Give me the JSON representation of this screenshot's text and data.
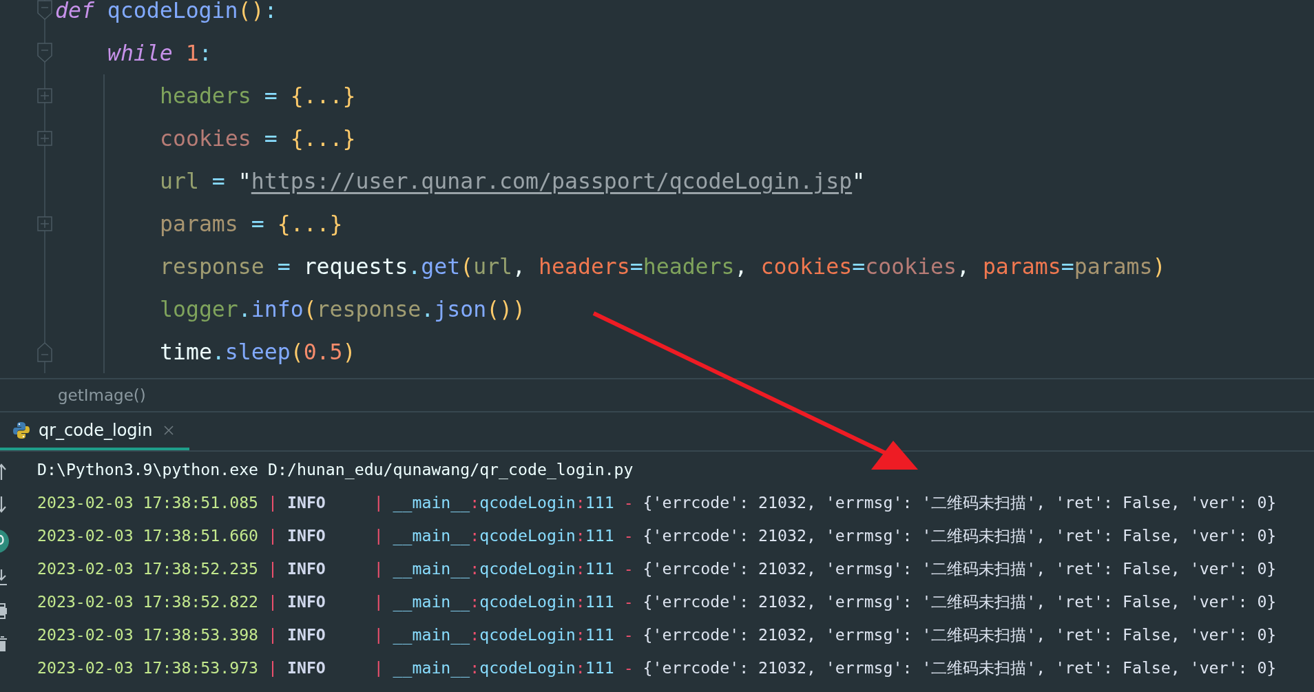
{
  "editor": {
    "code": [
      {
        "kind": "fold-start",
        "tokens": [
          {
            "text": "def",
            "kind": "keyword"
          },
          {
            "text": " qcodeLogin",
            "kind": "function"
          },
          {
            "text": "()",
            "kind": "bracket"
          },
          {
            "text": ":",
            "kind": "operator"
          }
        ],
        "children": [
          {
            "kind": "fold-start",
            "tokens": [
              {
                "text": "while",
                "kind": "keyword"
              },
              {
                "text": " 1",
                "kind": "number"
              },
              {
                "text": ":",
                "kind": "operator"
              }
            ],
            "children": [
              {
                "kind": "fold-collapsed",
                "tokens": [
                  {
                    "text": "headers",
                    "kind": "var-green"
                  },
                  {
                    "text": " = ",
                    "kind": "operator"
                  },
                  {
                    "text": "{...}",
                    "kind": "bracket"
                  }
                ]
              },
              {
                "kind": "fold-collapsed",
                "tokens": [
                  {
                    "text": "cookies",
                    "kind": "var-rose"
                  },
                  {
                    "text": " = ",
                    "kind": "operator"
                  },
                  {
                    "text": "{...}",
                    "kind": "bracket"
                  }
                ]
              },
              {
                "kind": "plain",
                "tokens": [
                  {
                    "text": "url",
                    "kind": "var-olive"
                  },
                  {
                    "text": " = ",
                    "kind": "operator"
                  },
                  {
                    "text": "\"",
                    "kind": "plain"
                  },
                  {
                    "text": "https://user.qunar.com/passport/qcodeLogin.jsp",
                    "kind": "link"
                  },
                  {
                    "text": "\"",
                    "kind": "plain"
                  }
                ]
              },
              {
                "kind": "fold-collapsed",
                "tokens": [
                  {
                    "text": "params",
                    "kind": "var-tan"
                  },
                  {
                    "text": " = ",
                    "kind": "operator"
                  },
                  {
                    "text": "{...}",
                    "kind": "bracket"
                  }
                ]
              },
              {
                "kind": "plain",
                "tokens": [
                  {
                    "text": "response",
                    "kind": "var-khaki"
                  },
                  {
                    "text": " = ",
                    "kind": "operator"
                  },
                  {
                    "text": "requests",
                    "kind": "plain"
                  },
                  {
                    "text": ".",
                    "kind": "operator"
                  },
                  {
                    "text": "get",
                    "kind": "function"
                  },
                  {
                    "text": "(",
                    "kind": "bracket"
                  },
                  {
                    "text": "url",
                    "kind": "var-olive"
                  },
                  {
                    "text": ", ",
                    "kind": "plain"
                  },
                  {
                    "text": "headers",
                    "kind": "kwarg"
                  },
                  {
                    "text": "=",
                    "kind": "operator"
                  },
                  {
                    "text": "headers",
                    "kind": "var-green"
                  },
                  {
                    "text": ", ",
                    "kind": "plain"
                  },
                  {
                    "text": "cookies",
                    "kind": "kwarg"
                  },
                  {
                    "text": "=",
                    "kind": "operator"
                  },
                  {
                    "text": "cookies",
                    "kind": "var-rose"
                  },
                  {
                    "text": ", ",
                    "kind": "plain"
                  },
                  {
                    "text": "params",
                    "kind": "kwarg"
                  },
                  {
                    "text": "=",
                    "kind": "operator"
                  },
                  {
                    "text": "params",
                    "kind": "var-tan"
                  },
                  {
                    "text": ")",
                    "kind": "bracket"
                  }
                ]
              },
              {
                "kind": "plain",
                "tokens": [
                  {
                    "text": "logger",
                    "kind": "var-green"
                  },
                  {
                    "text": ".",
                    "kind": "operator"
                  },
                  {
                    "text": "info",
                    "kind": "function"
                  },
                  {
                    "text": "(",
                    "kind": "bracket"
                  },
                  {
                    "text": "response",
                    "kind": "var-khaki"
                  },
                  {
                    "text": ".",
                    "kind": "operator"
                  },
                  {
                    "text": "json",
                    "kind": "function"
                  },
                  {
                    "text": "())",
                    "kind": "bracket"
                  }
                ]
              },
              {
                "kind": "fold-end",
                "tokens": [
                  {
                    "text": "time",
                    "kind": "plain"
                  },
                  {
                    "text": ".",
                    "kind": "operator"
                  },
                  {
                    "text": "sleep",
                    "kind": "function"
                  },
                  {
                    "text": "(",
                    "kind": "bracket"
                  },
                  {
                    "text": "0.5",
                    "kind": "number"
                  },
                  {
                    "text": ")",
                    "kind": "bracket"
                  }
                ]
              }
            ]
          }
        ]
      }
    ],
    "breadcrumb": "getImage()"
  },
  "run_panel": {
    "tabs": [
      {
        "label": "qr_code_login",
        "selected": true
      }
    ],
    "soft_wrap": {
      "on": true
    },
    "lines": [
      {
        "parts": [
          {
            "text": "D:\\Python3.9\\python.exe D:/hunan_edu/qunawang/qr_code_login.py",
            "kind": "cmd"
          }
        ]
      },
      {
        "parts": [
          {
            "text": "2023-02-03 17:38:51.085",
            "kind": "time"
          },
          {
            "text": " | ",
            "kind": "sep"
          },
          {
            "text": "INFO     ",
            "kind": "level"
          },
          {
            "text": "| ",
            "kind": "sep"
          },
          {
            "text": "__main__",
            "kind": "name"
          },
          {
            "text": ":",
            "kind": "sep"
          },
          {
            "text": "qcodeLogin",
            "kind": "name"
          },
          {
            "text": ":",
            "kind": "sep"
          },
          {
            "text": "111",
            "kind": "name"
          },
          {
            "text": " - ",
            "kind": "sep"
          },
          {
            "text": "{'errcode': 21032, 'errmsg': '二维码未扫描', 'ret': False, 'ver': 0}",
            "kind": "msg"
          }
        ]
      },
      {
        "parts": [
          {
            "text": "2023-02-03 17:38:51.660",
            "kind": "time"
          },
          {
            "text": " | ",
            "kind": "sep"
          },
          {
            "text": "INFO     ",
            "kind": "level"
          },
          {
            "text": "| ",
            "kind": "sep"
          },
          {
            "text": "__main__",
            "kind": "name"
          },
          {
            "text": ":",
            "kind": "sep"
          },
          {
            "text": "qcodeLogin",
            "kind": "name"
          },
          {
            "text": ":",
            "kind": "sep"
          },
          {
            "text": "111",
            "kind": "name"
          },
          {
            "text": " - ",
            "kind": "sep"
          },
          {
            "text": "{'errcode': 21032, 'errmsg': '二维码未扫描', 'ret': False, 'ver': 0}",
            "kind": "msg"
          }
        ]
      },
      {
        "parts": [
          {
            "text": "2023-02-03 17:38:52.235",
            "kind": "time"
          },
          {
            "text": " | ",
            "kind": "sep"
          },
          {
            "text": "INFO     ",
            "kind": "level"
          },
          {
            "text": "| ",
            "kind": "sep"
          },
          {
            "text": "__main__",
            "kind": "name"
          },
          {
            "text": ":",
            "kind": "sep"
          },
          {
            "text": "qcodeLogin",
            "kind": "name"
          },
          {
            "text": ":",
            "kind": "sep"
          },
          {
            "text": "111",
            "kind": "name"
          },
          {
            "text": " - ",
            "kind": "sep"
          },
          {
            "text": "{'errcode': 21032, 'errmsg': '二维码未扫描', 'ret': False, 'ver': 0}",
            "kind": "msg"
          }
        ]
      },
      {
        "parts": [
          {
            "text": "2023-02-03 17:38:52.822",
            "kind": "time"
          },
          {
            "text": " | ",
            "kind": "sep"
          },
          {
            "text": "INFO     ",
            "kind": "level"
          },
          {
            "text": "| ",
            "kind": "sep"
          },
          {
            "text": "__main__",
            "kind": "name"
          },
          {
            "text": ":",
            "kind": "sep"
          },
          {
            "text": "qcodeLogin",
            "kind": "name"
          },
          {
            "text": ":",
            "kind": "sep"
          },
          {
            "text": "111",
            "kind": "name"
          },
          {
            "text": " - ",
            "kind": "sep"
          },
          {
            "text": "{'errcode': 21032, 'errmsg': '二维码未扫描', 'ret': False, 'ver': 0}",
            "kind": "msg"
          }
        ]
      },
      {
        "parts": [
          {
            "text": "2023-02-03 17:38:53.398",
            "kind": "time"
          },
          {
            "text": " | ",
            "kind": "sep"
          },
          {
            "text": "INFO     ",
            "kind": "level"
          },
          {
            "text": "| ",
            "kind": "sep"
          },
          {
            "text": "__main__",
            "kind": "name"
          },
          {
            "text": ":",
            "kind": "sep"
          },
          {
            "text": "qcodeLogin",
            "kind": "name"
          },
          {
            "text": ":",
            "kind": "sep"
          },
          {
            "text": "111",
            "kind": "name"
          },
          {
            "text": " - ",
            "kind": "sep"
          },
          {
            "text": "{'errcode': 21032, 'errmsg': '二维码未扫描', 'ret': False, 'ver': 0}",
            "kind": "msg"
          }
        ]
      },
      {
        "parts": [
          {
            "text": "2023-02-03 17:38:53.973",
            "kind": "time"
          },
          {
            "text": " | ",
            "kind": "sep"
          },
          {
            "text": "INFO     ",
            "kind": "level"
          },
          {
            "text": "| ",
            "kind": "sep"
          },
          {
            "text": "__main__",
            "kind": "name"
          },
          {
            "text": ":",
            "kind": "sep"
          },
          {
            "text": "qcodeLogin",
            "kind": "name"
          },
          {
            "text": ":",
            "kind": "sep"
          },
          {
            "text": "111",
            "kind": "name"
          },
          {
            "text": " - ",
            "kind": "sep"
          },
          {
            "text": "{'errcode': 21032, 'errmsg': '二维码未扫描', 'ret': False, 'ver': 0}",
            "kind": "msg"
          }
        ]
      }
    ]
  }
}
